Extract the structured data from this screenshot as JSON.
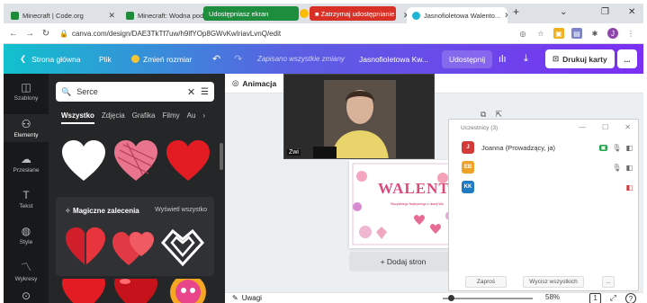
{
  "tabs": [
    {
      "label": "Minecraft | Code.org",
      "favicon": "#1f8a3b"
    },
    {
      "label": "Minecraft: Wodna podró...",
      "favicon": "#1f8a3b"
    },
    {
      "label": "Jasnofioletowa Walento...",
      "favicon": "#1fb6d5"
    }
  ],
  "sharing": {
    "share_label": "Udostępniasz ekran",
    "stop_label": "■ Zatrzymaj udostępnianie"
  },
  "browser": {
    "url": "canva.com/design/DAE3TkTf7uw/h9lfYOp8GWvKwIriavLvnQ/edit",
    "new_tab": "+",
    "window_minimize": "⌄",
    "window_restore": "❐",
    "window_close": "✕",
    "profile_initial": "J"
  },
  "header": {
    "home": "Strona główna",
    "file": "Plik",
    "resize": "Zmień rozmiar",
    "saved_status": "Zapisano wszystkie zmiany",
    "design_title": "Jasnofioletowa Kw...",
    "share": "Udostępnij",
    "print": "Drukuj karty",
    "more": "..."
  },
  "sidebar": [
    {
      "label": "Szablony",
      "icon": "template-icon"
    },
    {
      "label": "Elementy",
      "icon": "shapes-icon"
    },
    {
      "label": "Przesłane",
      "icon": "upload-icon"
    },
    {
      "label": "Tekst",
      "icon": "text-icon"
    },
    {
      "label": "Style",
      "icon": "palette-icon"
    },
    {
      "label": "Wykresy",
      "icon": "chart-icon"
    }
  ],
  "panel": {
    "search_value": "Serce",
    "categories": [
      "Wszystko",
      "Zdjęcia",
      "Grafika",
      "Filmy",
      "Au"
    ],
    "magic_title": "Magiczne zalecenia",
    "magic_see_all": "Wyświetl wszystko"
  },
  "canvas": {
    "animation": "Animacja",
    "camera_name": "Zwi",
    "design_title": "WALENTY",
    "design_sub": "Wszystkiego Najlepszego z okazji Wa",
    "add_page": "+ Dodaj stron",
    "notes": "Uwagi",
    "zoom": "58%",
    "page_count": "1",
    "help": "?"
  },
  "participants": {
    "title": "Uczestnicy (3)",
    "rows": [
      {
        "initials": "J",
        "name": "Joanna (Prowadzący, ja)",
        "color": "#d33b3b"
      },
      {
        "initials": "EB",
        "name": "",
        "color": "#f0a12a"
      },
      {
        "initials": "KK",
        "name": "",
        "color": "#1f7ac2"
      }
    ],
    "invite": "Zaproś",
    "mute_all": "Wycisz wszystkich",
    "more": "..."
  }
}
